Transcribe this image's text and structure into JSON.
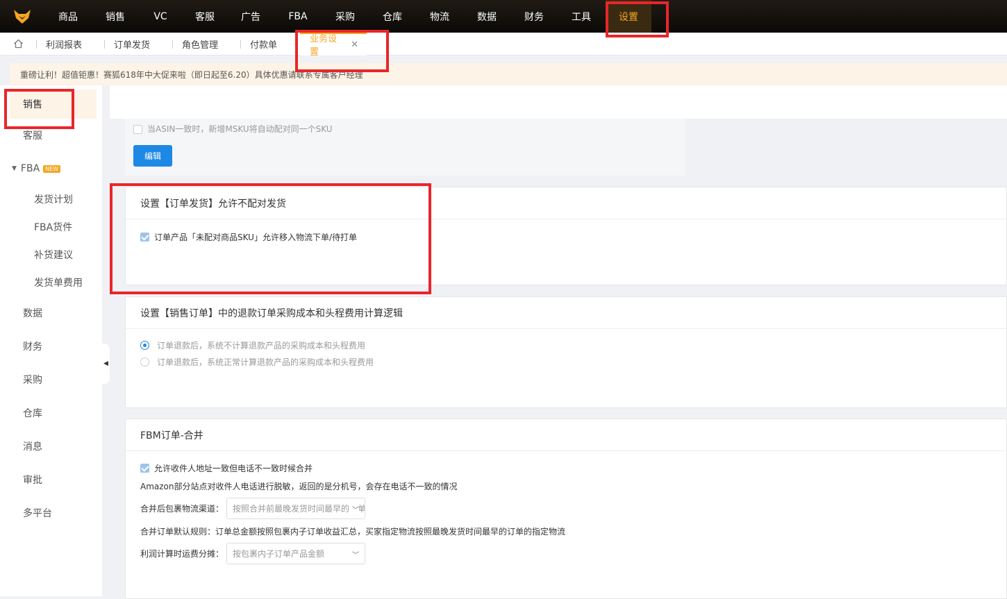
{
  "topnav": {
    "items": [
      "商品",
      "销售",
      "VC",
      "客服",
      "广告",
      "FBA",
      "采购",
      "仓库",
      "物流",
      "数据",
      "财务",
      "工具",
      "设置"
    ],
    "active": "设置"
  },
  "tabs": {
    "items": [
      "利润报表",
      "订单发货",
      "角色管理",
      "付款单"
    ],
    "active_label": "业务设置",
    "close_glyph": "✕"
  },
  "banner": {
    "text": "重磅让利！超值钜惠！赛狐618年中大促来啦（即日起至6.20）具体优惠请联系专属客户经理"
  },
  "sidebar": {
    "active": "销售",
    "kefu": "客服",
    "fba": "FBA",
    "new_badge": "NEW",
    "fba_sub": [
      "发货计划",
      "FBA货件",
      "补货建议",
      "发货单费用"
    ],
    "rest": [
      "数据",
      "财务",
      "采购",
      "仓库",
      "消息",
      "审批",
      "多平台"
    ]
  },
  "section_top": {
    "checkbox_label": "当ASIN一致时，新增MSKU将自动配对同一个SKU",
    "edit_button": "编辑"
  },
  "section_unmatched": {
    "title": "设置【订单发货】允许不配对发货",
    "checkbox_label": "订单产品「未配对商品SKU」允许移入物流下单/待打单",
    "checked": true
  },
  "section_refund": {
    "title": "设置【销售订单】中的退款订单采购成本和头程费用计算逻辑",
    "option1": "订单退款后，系统不计算退款产品的采购成本和头程费用",
    "option2": "订单退款后，系统正常计算退款产品的采购成本和头程费用",
    "selected": 1
  },
  "section_fbm": {
    "title": "FBM订单-合并",
    "checkbox_label": "允许收件人地址一致但电话不一致时候合并",
    "checked": true,
    "note": "Amazon部分站点对收件人电话进行脱敏，返回的是分机号，会存在电话不一致的情况",
    "channel_label": "合并后包裹物流渠道：",
    "channel_value": "按照合并前最晚发货时间最早的订单",
    "rule_note": "合并订单默认规则：订单总金额按照包裹内子订单收益汇总，买家指定物流按照最晚发货时间最早的订单的指定物流",
    "freight_label": "利润计算时运费分摊：",
    "freight_value": "按包裹内子订单产品金额"
  },
  "colors": {
    "accent": "#f5a623",
    "primary": "#1e88e5",
    "highlight": "#e8262b"
  }
}
